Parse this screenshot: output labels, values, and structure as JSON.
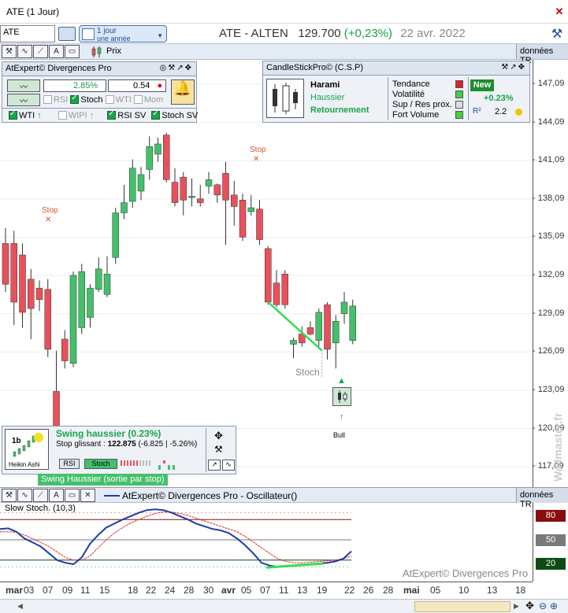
{
  "window": {
    "title": "ATE (1 Jour)"
  },
  "toolbar": {
    "symbol_value": "ATE",
    "period_line1": "1 jour",
    "period_line2": "une année",
    "instrument": "ATE - ALTEN",
    "price": "129.700",
    "change": "(+0,23%)",
    "date": "22 avr. 2022",
    "price_label": "Prix",
    "data_tr": "données TR"
  },
  "atexpert": {
    "title": "AtExpert© Divergences Pro",
    "pct": "2.85%",
    "r2": "0.54",
    "stoch": "Stoch",
    "rsi": "RSI",
    "wti": "WTI",
    "mom": "Mom",
    "wti2": "WTI",
    "wipi": "WIPI",
    "rsisv": "RSI SV",
    "stochsv": "Stoch SV"
  },
  "candle": {
    "title": "CandleStickPro© (C.S.P)",
    "pattern": "Harami",
    "direction": "Haussier",
    "kind": "Retournement",
    "tendance": "Tendance",
    "volatilite": "Volatilité",
    "supres": "Sup / Res prox.",
    "fortvol": "Fort Volume",
    "new": "New",
    "pct": "+0.23%",
    "r2": "2.2"
  },
  "swing": {
    "period": "1b",
    "chart_label": "Heikin Ashi",
    "title": "Swing haussier (0.23%)",
    "stop_label": "Stop glissant : ",
    "stop_value": "122.875",
    "stop_delta": " (-6.825 | -5.26%)",
    "rsi": "RSI",
    "stoch": "Stoch",
    "tooltip": "Swing Haussier (sortie par stop)"
  },
  "annotations": {
    "stop1": "Stop",
    "stop2": "Stop",
    "stoch": "Stoch",
    "bull": "Bull",
    "watermark": "Wallmaster.fr"
  },
  "price_axis": [
    "147,09",
    "144,09",
    "141,09",
    "138,09",
    "135,09",
    "132,09",
    "129,09",
    "126,09",
    "123,09",
    "120,09",
    "117,09"
  ],
  "oscillator": {
    "toolbar_title": "AtExpert© Divergences Pro - Oscillateur()",
    "data_tr": "données TR",
    "indicator": "Slow Stoch. (10,3)",
    "levels": [
      "80",
      "50",
      "20"
    ],
    "watermark": "AtExpert© Divergences Pro"
  },
  "x_axis": [
    "mar",
    "03",
    "07",
    "09",
    "11",
    "15",
    "18",
    "22",
    "24",
    "28",
    "30",
    "avr",
    "05",
    "07",
    "11",
    "13",
    "19",
    "22",
    "26",
    "28",
    "mai",
    "05",
    "10",
    "13",
    "18"
  ],
  "chart_data": {
    "type": "candlestick",
    "ylim": [
      115.5,
      149
    ],
    "candles": [
      {
        "o": 134.6,
        "c": 131.4,
        "h": 135.8,
        "l": 130.8
      },
      {
        "o": 134.6,
        "c": 130.0,
        "h": 135.6,
        "l": 128.2
      },
      {
        "o": 133.7,
        "c": 129.2,
        "h": 134.6,
        "l": 128.0
      },
      {
        "o": 131.8,
        "c": 129.5,
        "h": 132.6,
        "l": 127.1
      },
      {
        "o": 131.1,
        "c": 130.2,
        "h": 131.7,
        "l": 129.3
      },
      {
        "o": 131.0,
        "c": 126.3,
        "h": 131.8,
        "l": 125.7
      },
      {
        "o": 123.0,
        "c": 119.8,
        "h": 126.2,
        "l": 119.0
      },
      {
        "o": 127.1,
        "c": 125.4,
        "h": 127.8,
        "l": 124.8
      },
      {
        "o": 125.2,
        "c": 132.1,
        "h": 132.4,
        "l": 124.9
      },
      {
        "o": 128.0,
        "c": 132.4,
        "h": 133.0,
        "l": 127.5
      },
      {
        "o": 128.8,
        "c": 131.1,
        "h": 131.4,
        "l": 128.0
      },
      {
        "o": 131.0,
        "c": 132.6,
        "h": 133.5,
        "l": 130.8
      },
      {
        "o": 130.6,
        "c": 132.2,
        "h": 133.6,
        "l": 130.4
      },
      {
        "o": 133.5,
        "c": 137.0,
        "h": 137.4,
        "l": 133.0
      },
      {
        "o": 137.0,
        "c": 137.8,
        "h": 139.2,
        "l": 136.5
      },
      {
        "o": 137.9,
        "c": 140.5,
        "h": 141.2,
        "l": 137.4
      },
      {
        "o": 138.7,
        "c": 140.0,
        "h": 140.6,
        "l": 138.0
      },
      {
        "o": 140.4,
        "c": 142.2,
        "h": 143.0,
        "l": 139.6
      },
      {
        "o": 141.6,
        "c": 142.4,
        "h": 142.9,
        "l": 141.0
      },
      {
        "o": 143.1,
        "c": 139.6,
        "h": 143.3,
        "l": 139.4
      },
      {
        "o": 139.4,
        "c": 137.8,
        "h": 140.5,
        "l": 137.5
      },
      {
        "o": 139.8,
        "c": 138.0,
        "h": 140.2,
        "l": 136.8
      },
      {
        "o": 138.2,
        "c": 138.3,
        "h": 139.7,
        "l": 137.5
      },
      {
        "o": 138.1,
        "c": 137.8,
        "h": 139.2,
        "l": 137.5
      },
      {
        "o": 139.1,
        "c": 139.6,
        "h": 140.2,
        "l": 138.5
      },
      {
        "o": 139.2,
        "c": 138.4,
        "h": 139.3,
        "l": 137.8
      },
      {
        "o": 140.1,
        "c": 138.0,
        "h": 141.0,
        "l": 134.5
      },
      {
        "o": 138.4,
        "c": 137.5,
        "h": 139.5,
        "l": 136.0
      },
      {
        "o": 138.0,
        "c": 135.1,
        "h": 138.5,
        "l": 134.8
      },
      {
        "o": 137.1,
        "c": 137.4,
        "h": 138.4,
        "l": 136.8
      },
      {
        "o": 137.3,
        "c": 134.9,
        "h": 138.0,
        "l": 134.5
      },
      {
        "o": 134.2,
        "c": 130.0,
        "h": 134.4,
        "l": 129.8
      },
      {
        "o": 131.5,
        "c": 129.8,
        "h": 132.5,
        "l": 129.6
      },
      {
        "o": 132.2,
        "c": 129.8,
        "h": 132.5,
        "l": 129.5
      },
      {
        "o": 126.7,
        "c": 127.0,
        "h": 127.2,
        "l": 125.6
      },
      {
        "o": 127.5,
        "c": 126.8,
        "h": 128.1,
        "l": 126.5
      },
      {
        "o": 128.0,
        "c": 127.5,
        "h": 128.5,
        "l": 127.4
      },
      {
        "o": 127.0,
        "c": 129.2,
        "h": 129.5,
        "l": 126.4
      },
      {
        "o": 129.8,
        "c": 126.3,
        "h": 130.0,
        "l": 125.5
      },
      {
        "o": 126.8,
        "c": 128.5,
        "h": 129.0,
        "l": 124.8
      },
      {
        "o": 129.1,
        "c": 130.0,
        "h": 130.8,
        "l": 128.3
      },
      {
        "o": 127.0,
        "c": 129.7,
        "h": 130.2,
        "l": 126.7
      }
    ]
  },
  "stoch_data": {
    "k": [
      66,
      67,
      62,
      52,
      46,
      40,
      30,
      20,
      16,
      14,
      24,
      44,
      57,
      68,
      74,
      80,
      85,
      90,
      94,
      95,
      94,
      90,
      85,
      80,
      74,
      70,
      66,
      64,
      60,
      52,
      42,
      30,
      16,
      12,
      10,
      11,
      12,
      13,
      14,
      15,
      16,
      18,
      22,
      33
    ],
    "d": [
      62,
      62,
      61,
      57,
      52,
      46,
      40,
      32,
      24,
      20,
      20,
      26,
      38,
      50,
      60,
      68,
      75,
      80,
      85,
      89,
      91,
      91,
      89,
      86,
      82,
      78,
      74,
      70,
      66,
      62,
      55,
      47,
      38,
      30,
      22,
      18,
      16,
      16,
      17,
      18,
      19,
      20,
      22,
      26
    ]
  },
  "colors": {
    "bull": "#44c06a",
    "bear": "#e8515b",
    "accent": "#1b4f9b",
    "stoch_k": "#1f3da8",
    "stoch_d": "#d62f2f",
    "div": "#33dd55"
  }
}
